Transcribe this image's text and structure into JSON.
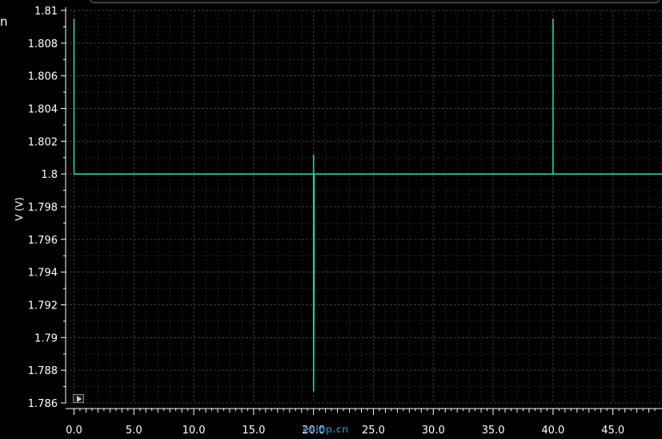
{
  "header": {
    "edge_letter": "n"
  },
  "watermark": {
    "text": "eelop.cn"
  },
  "colors": {
    "background": "#000000",
    "trace": "#2fd39a",
    "grid": "#3a3a3a",
    "axis_text": "#ffffff"
  },
  "controls": {
    "play_icon": "play-triangle-icon"
  },
  "chart_data": {
    "type": "line",
    "title": "",
    "xlabel": "",
    "ylabel": "V (V)",
    "xlim": [
      -0.7,
      49.1
    ],
    "ylim": [
      1.786,
      1.81
    ],
    "x_ticks": [
      "0.0",
      "5.0",
      "10.0",
      "15.0",
      "20.0",
      "25.0",
      "30.0",
      "35.0",
      "40.0",
      "45.0"
    ],
    "x_tick_values": [
      0,
      5,
      10,
      15,
      20,
      25,
      30,
      35,
      40,
      45
    ],
    "y_ticks": [
      "1.786",
      "1.788",
      "1.79",
      "1.792",
      "1.794",
      "1.796",
      "1.798",
      "1.8",
      "1.802",
      "1.804",
      "1.806",
      "1.808",
      "1.81"
    ],
    "y_tick_values": [
      1.786,
      1.788,
      1.79,
      1.792,
      1.794,
      1.796,
      1.798,
      1.8,
      1.802,
      1.804,
      1.806,
      1.808,
      1.81
    ],
    "grid": true,
    "legend": "none",
    "series": [
      {
        "color": "#2fd39a",
        "x": [
          0.0,
          0.0,
          0.0,
          0.0,
          0.0,
          0.0,
          20.0,
          20.0,
          20.0,
          20.0,
          20.05,
          20.05,
          20.05,
          40.0,
          40.0,
          40.0,
          40.0,
          40.0,
          40.05,
          49.1
        ],
        "y": [
          1.8,
          1.8047,
          1.8095,
          1.8047,
          1.8,
          1.8,
          1.8,
          1.8012,
          1.794,
          1.7867,
          1.794,
          1.8,
          1.8,
          1.8,
          1.8095,
          1.8047,
          1.8,
          1.8,
          1.8,
          1.8
        ]
      }
    ]
  }
}
